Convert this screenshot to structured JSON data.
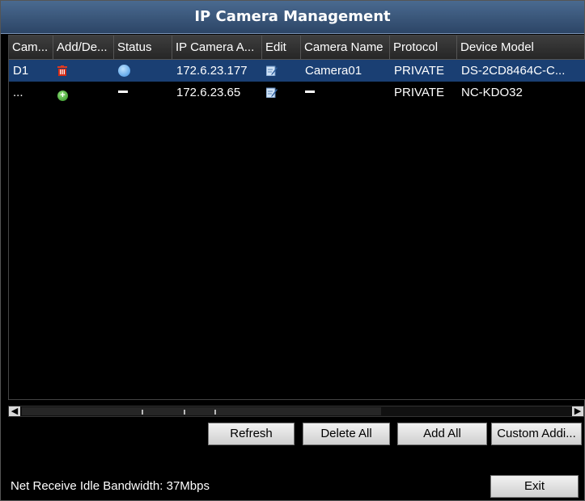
{
  "window": {
    "title": "IP Camera Management"
  },
  "table": {
    "headers": [
      "Cam...",
      "Add/De...",
      "Status",
      "IP Camera A...",
      "Edit",
      "Camera Name",
      "Protocol",
      "Device Model"
    ],
    "rows": [
      {
        "camera": "D1",
        "action_icon": "delete-icon",
        "status_icon": "online-status-icon",
        "ip": "172.6.23.177",
        "edit_icon": "edit-icon",
        "name": "Camera01",
        "protocol": "PRIVATE",
        "model": "DS-2CD8464C-C...",
        "selected": true
      },
      {
        "camera": "...",
        "action_icon": "add-icon",
        "status_icon": "dash-icon",
        "ip": "172.6.23.65",
        "edit_icon": "edit-icon",
        "name_icon": "dash-icon",
        "protocol": "PRIVATE",
        "model": "NC-KDO32",
        "selected": false
      }
    ]
  },
  "buttons": {
    "refresh": "Refresh",
    "delete_all": "Delete All",
    "add_all": "Add All",
    "custom_add": "Custom Addi...",
    "exit": "Exit"
  },
  "status": {
    "bandwidth": "Net Receive Idle Bandwidth: 37Mbps"
  },
  "colors": {
    "title_bar": "#3a5780",
    "selected_row": "#1a3f73",
    "background": "#000000"
  }
}
